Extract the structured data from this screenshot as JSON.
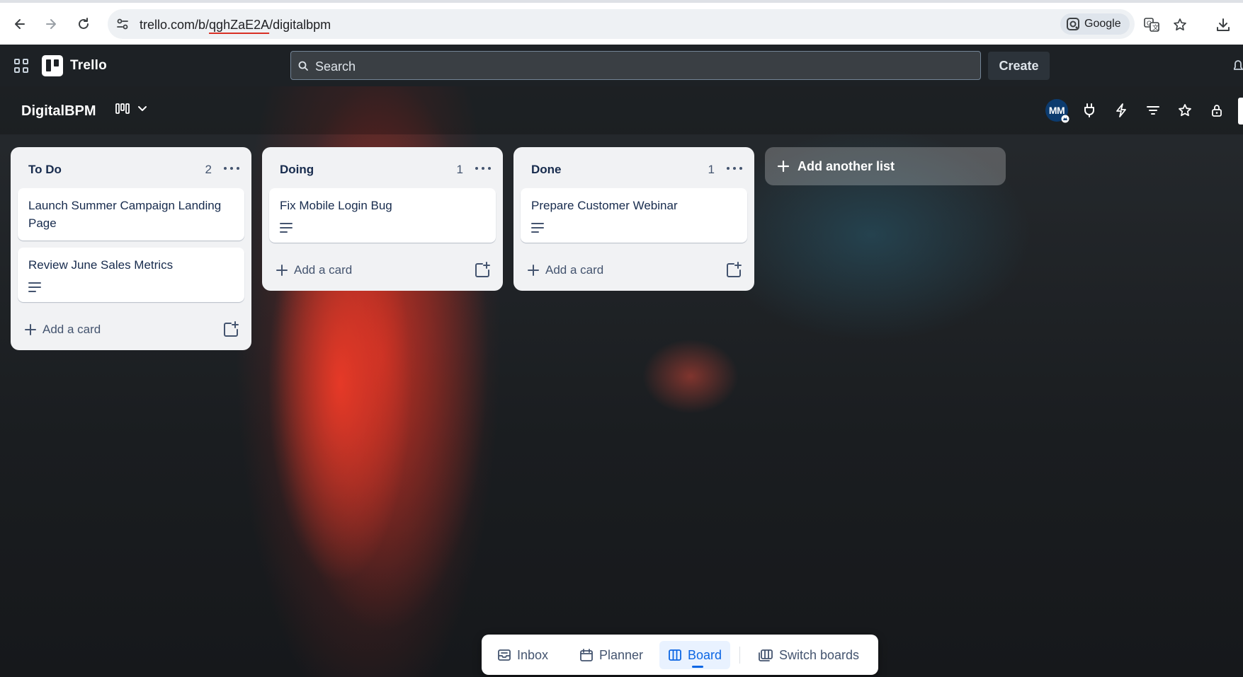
{
  "browser": {
    "url_prefix": "trello.com/b/",
    "url_highlight": "qghZaE2A",
    "url_suffix": "/digitalbpm",
    "lens_label": "Google"
  },
  "header": {
    "app_name": "Trello",
    "search_placeholder": "Search",
    "create_label": "Create"
  },
  "board": {
    "title": "DigitalBPM",
    "member_initials": "MM"
  },
  "lists": [
    {
      "title": "To Do",
      "count": "2",
      "add_card_label": "Add a card",
      "cards": [
        {
          "title": "Launch Summer Campaign Landing Page",
          "has_description": false
        },
        {
          "title": "Review June Sales Metrics",
          "has_description": true
        }
      ]
    },
    {
      "title": "Doing",
      "count": "1",
      "add_card_label": "Add a card",
      "cards": [
        {
          "title": "Fix Mobile Login Bug",
          "has_description": true
        }
      ]
    },
    {
      "title": "Done",
      "count": "1",
      "add_card_label": "Add a card",
      "cards": [
        {
          "title": "Prepare Customer Webinar",
          "has_description": true
        }
      ]
    }
  ],
  "add_list_label": "Add another list",
  "dock": {
    "items": [
      {
        "label": "Inbox",
        "icon": "inbox-icon"
      },
      {
        "label": "Planner",
        "icon": "calendar-icon"
      },
      {
        "label": "Board",
        "icon": "board-icon",
        "active": true
      },
      {
        "label": "Switch boards",
        "icon": "switch-boards-icon"
      }
    ]
  },
  "colors": {
    "header_bg": "#1d2125",
    "list_bg": "#f1f2f4",
    "accent": "#0c66e4",
    "avatar_bg": "#0c3b6e"
  }
}
